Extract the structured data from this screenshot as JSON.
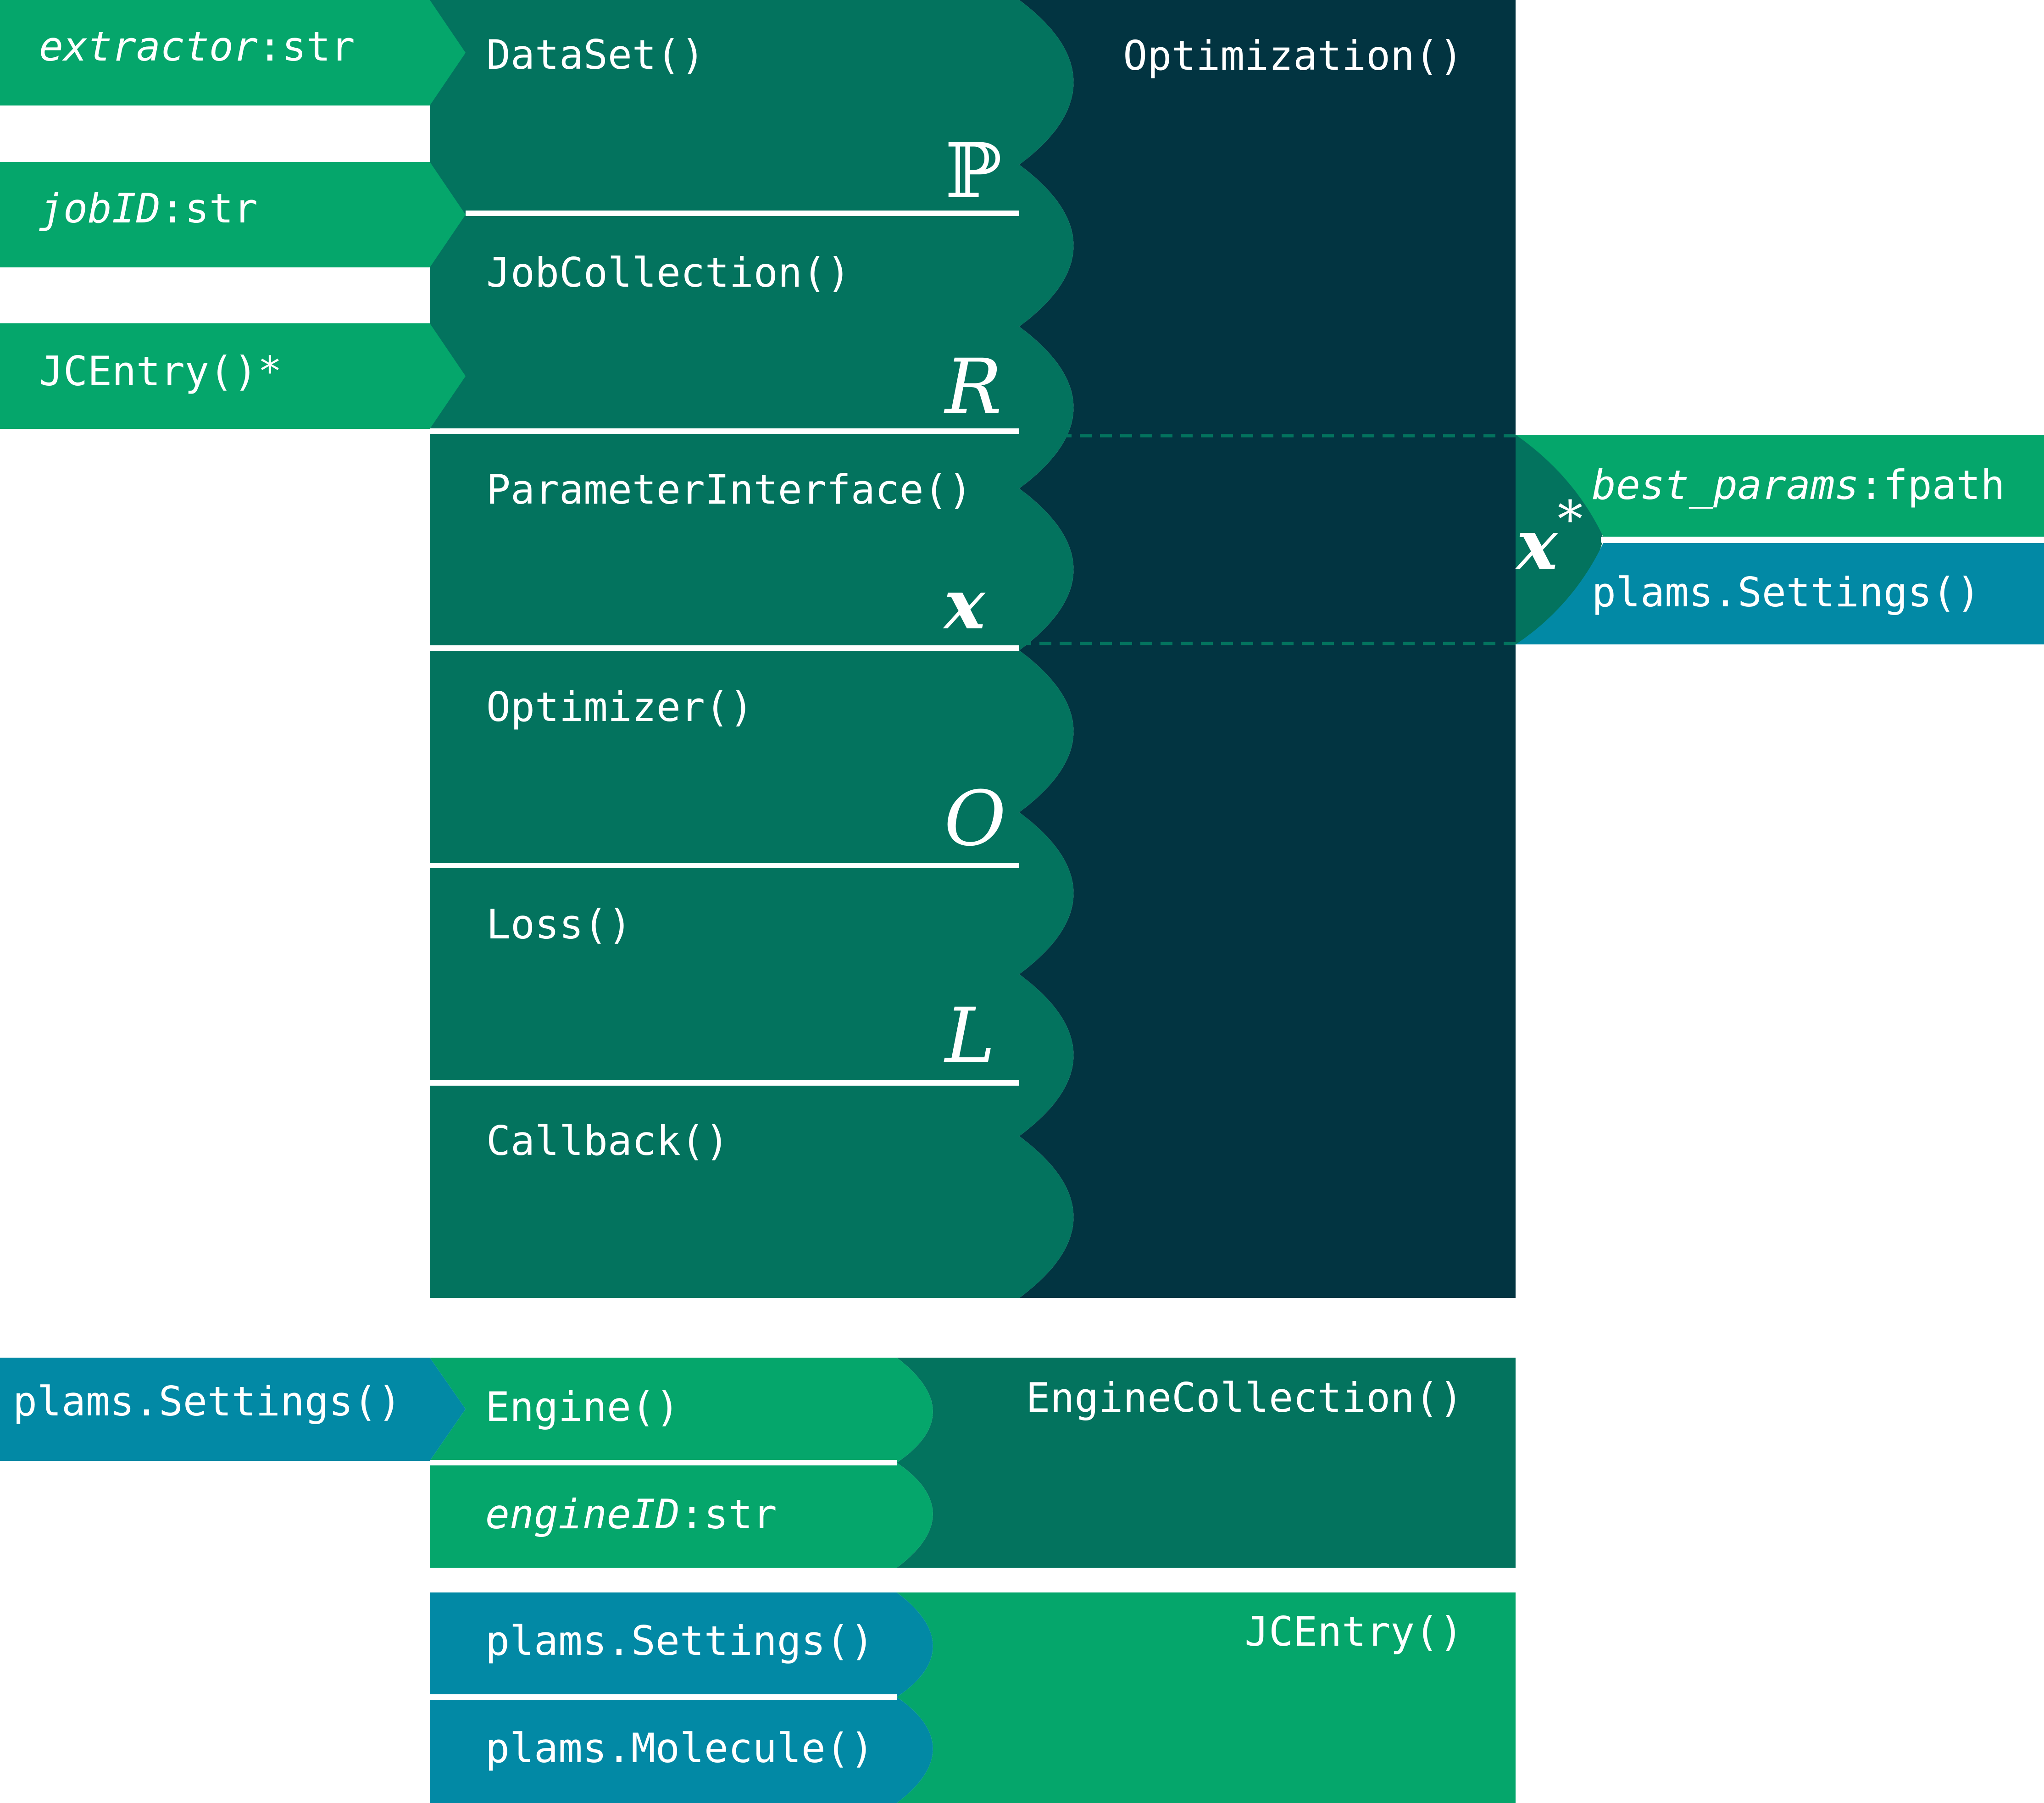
{
  "colors": {
    "green": "#05a66b",
    "teal": "#03735e",
    "navy": "#023441",
    "blue": "#0289a5",
    "white": "#ffffff"
  },
  "inputs": {
    "extractor": {
      "name": "extractor",
      "type": ":str"
    },
    "jobid": {
      "name": "jobID",
      "type": ":str"
    },
    "jcentry": {
      "label": "JCEntry()*"
    }
  },
  "optimization": {
    "title": "Optimization()",
    "components": [
      {
        "label": "DataSet()",
        "symbol": "ℙ"
      },
      {
        "label": "JobCollection()",
        "symbol": "R"
      },
      {
        "label": "ParameterInterface()",
        "symbol": "x"
      },
      {
        "label": "Optimizer()",
        "symbol": "O"
      },
      {
        "label": "Loss()",
        "symbol": "L"
      },
      {
        "label": "Callback()",
        "symbol": ""
      }
    ]
  },
  "output": {
    "symbol": "x",
    "superscript": "*",
    "best_params": {
      "name": "best_params",
      "type": ":fpath"
    },
    "settings": "plams.Settings()"
  },
  "engine_collection": {
    "input_settings": "plams.Settings()",
    "engine": "Engine()",
    "engine_id": {
      "name": "engineID",
      "type": ":str"
    },
    "title": "EngineCollection()"
  },
  "jcentry_block": {
    "settings": "plams.Settings()",
    "molecule": "plams.Molecule()",
    "title": "JCEntry()"
  }
}
